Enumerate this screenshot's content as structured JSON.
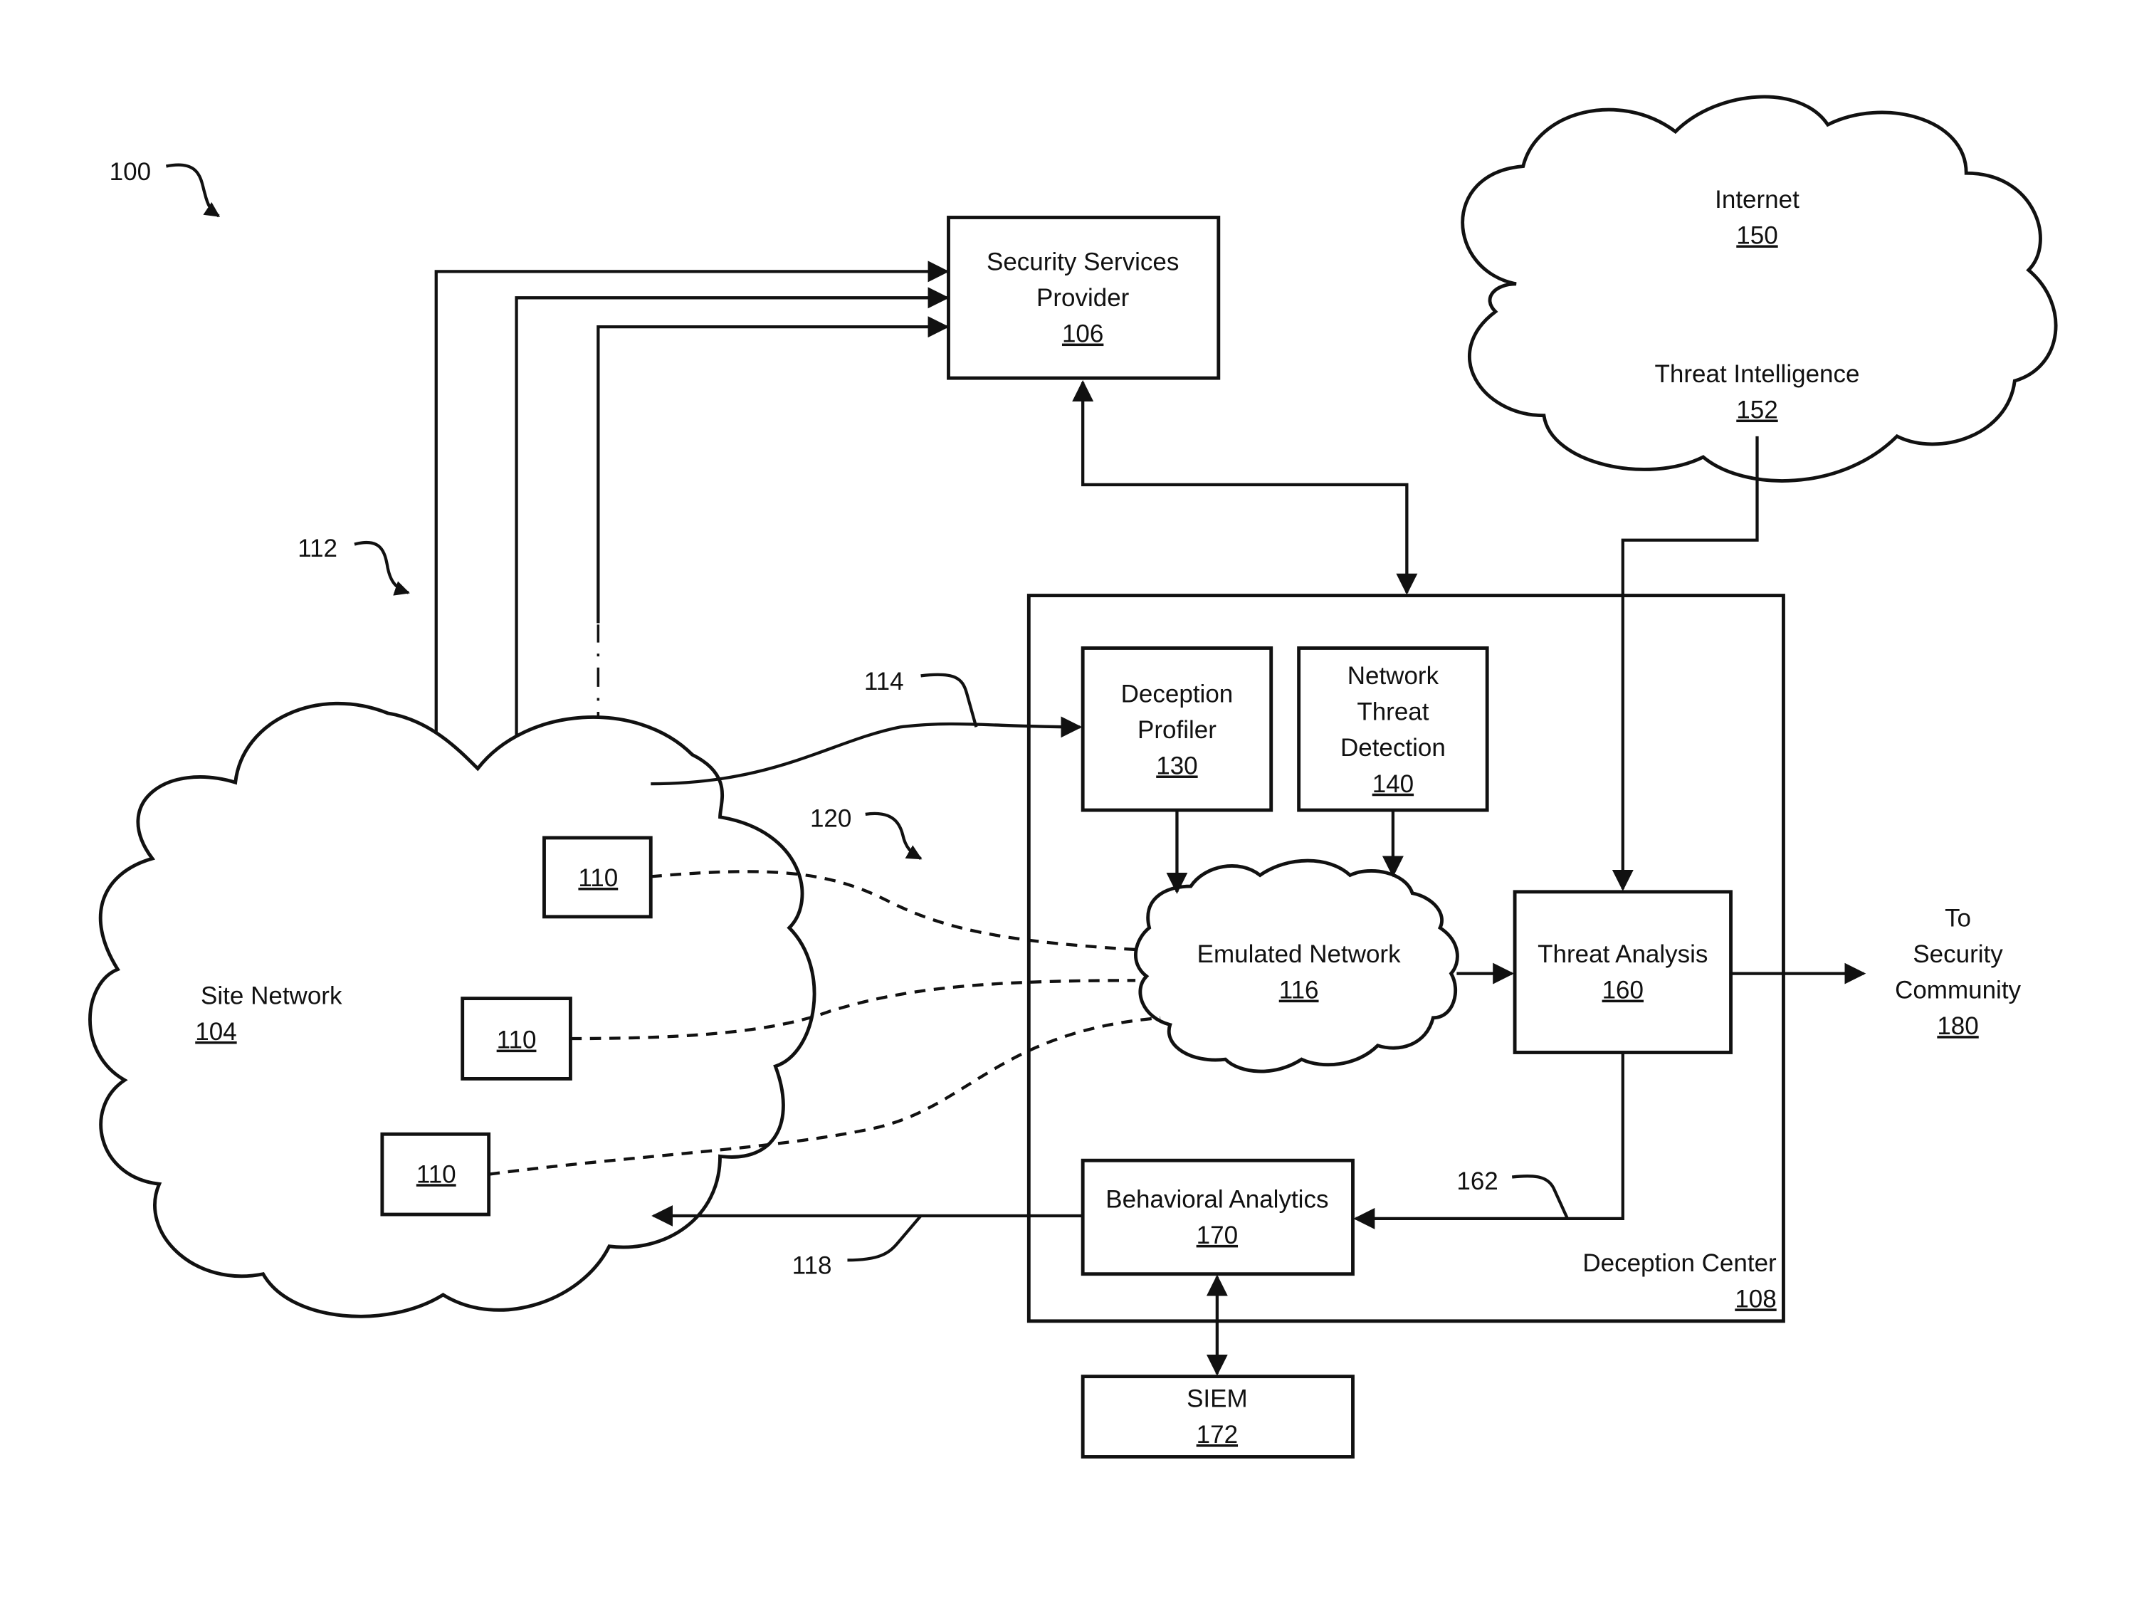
{
  "figure": {
    "ref": "100",
    "nodes": {
      "security_services_provider": {
        "label": [
          "Security Services",
          "Provider"
        ],
        "ref": "106"
      },
      "internet": {
        "label": [
          "Internet"
        ],
        "ref": "150"
      },
      "threat_intelligence": {
        "label": [
          "Threat Intelligence"
        ],
        "ref": "152"
      },
      "site_network": {
        "label": [
          "Site Network"
        ],
        "ref": "104"
      },
      "deception_center": {
        "label": [
          "Deception Center"
        ],
        "ref": "108"
      },
      "deception_profiler": {
        "label": [
          "Deception",
          "Profiler"
        ],
        "ref": "130"
      },
      "network_threat_detection": {
        "label": [
          "Network",
          "Threat",
          "Detection"
        ],
        "ref": "140"
      },
      "emulated_network": {
        "label": [
          "Emulated Network"
        ],
        "ref": "116"
      },
      "threat_analysis": {
        "label": [
          "Threat Analysis"
        ],
        "ref": "160"
      },
      "behavioral_analytics": {
        "label": [
          "Behavioral Analytics"
        ],
        "ref": "170"
      },
      "siem": {
        "label": [
          "SIEM"
        ],
        "ref": "172"
      },
      "security_community": {
        "label": [
          "To",
          "Security",
          "Community"
        ],
        "ref": "180"
      },
      "sensor": {
        "ref": "110"
      }
    },
    "callouts": {
      "c112": "112",
      "c114": "114",
      "c118": "118",
      "c120": "120",
      "c162": "162"
    }
  }
}
